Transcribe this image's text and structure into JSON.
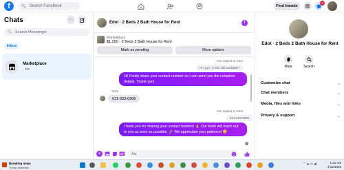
{
  "topbar": {
    "logo": "f",
    "search_placeholder": "Search Facebook",
    "find_friends": "Find friends",
    "notification_count": "2"
  },
  "left": {
    "title": "Chats",
    "search_placeholder": "Search Messenger",
    "filter_inbox": "Inbox",
    "conversations": [
      {
        "name": "Marketplace",
        "time": "· 4m"
      }
    ]
  },
  "chat": {
    "title": "Edot · 2 Beds 2 Bath House for Rent",
    "marketplace_label": "Marketplace",
    "listing": "$1,250 · 2 Beds 2 Bath House for Rent",
    "mark_pending": "Mark as pending",
    "more_options": "More options",
    "messages": {
      "reply_note_1": "You replied to Edot",
      "quote_1": "Hi Layo, is this still available?",
      "out_1": "Hi! Kindly share your contact number so I can send you the complete details. Thank you!",
      "sender_1": "Edot",
      "in_1": "631-933-0908",
      "reply_note_2": "You replied to Edot",
      "quote_2": "631-933-0908",
      "out_2": "Thank you for sharing your contact number! 🙏 Our team will reach out to you as soon as possible. 🚀 We appreciate your patience! 😊"
    },
    "composer_placeholder": "Aa"
  },
  "right": {
    "name": "Edot · 2 Beds 2 Bath House for Rent",
    "mute": "Mute",
    "search": "Search",
    "sections": [
      "Customize chat",
      "Chat members",
      "Media, files and links",
      "Privacy & support"
    ]
  },
  "taskbar": {
    "news_title": "Breaking news",
    "news_sub": "Trump administr...",
    "time": "1:31 AM",
    "date": "4/12/2025"
  },
  "colors": {
    "brand": "#1877f2",
    "bubble": "#a033ff"
  }
}
